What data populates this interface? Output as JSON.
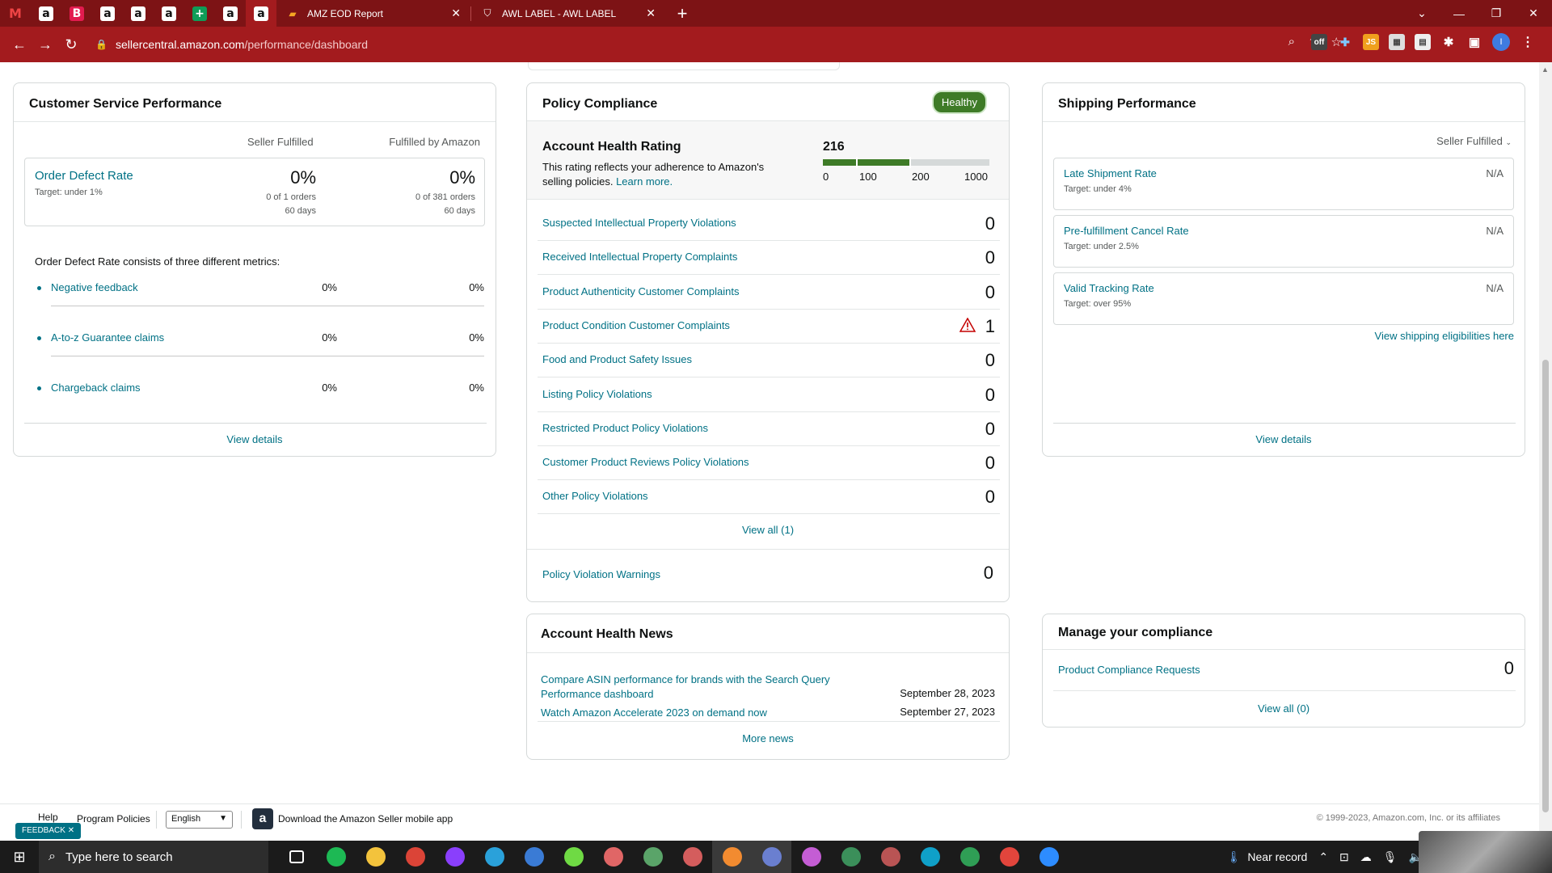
{
  "browser": {
    "pinned_tabs": [
      {
        "icon": "gmail-icon",
        "glyph": "M"
      },
      {
        "icon": "amazon-icon",
        "glyph": "a"
      },
      {
        "icon": "b-app-icon",
        "glyph": "B"
      },
      {
        "icon": "amazon-icon",
        "glyph": "a"
      },
      {
        "icon": "amazon-icon",
        "glyph": "a"
      },
      {
        "icon": "amazon-icon",
        "glyph": "a"
      },
      {
        "icon": "sheets-icon",
        "glyph": "+"
      },
      {
        "icon": "amazon-icon",
        "glyph": "a"
      },
      {
        "icon": "amazon-icon",
        "glyph": "a"
      }
    ],
    "tabs": [
      {
        "title": "AMZ EOD Report",
        "icon": "report-icon"
      },
      {
        "title": "AWL LABEL - AWL LABEL",
        "icon": "awl-icon"
      }
    ],
    "url_host": "sellercentral.amazon.com",
    "url_path": "/performance/dashboard",
    "profile_initial": "I"
  },
  "customer_service": {
    "title": "Customer Service Performance",
    "col_seller": "Seller Fulfilled",
    "col_amazon": "Fulfilled by Amazon",
    "odr": {
      "title": "Order Defect Rate",
      "target": "Target: under 1%",
      "seller_value": "0%",
      "seller_orders": "0 of 1 orders",
      "seller_period": "60 days",
      "amazon_value": "0%",
      "amazon_orders": "0 of 381 orders",
      "amazon_period": "60 days"
    },
    "consists": "Order Defect Rate consists of three different metrics:",
    "metrics": [
      {
        "name": "Negative feedback",
        "seller": "0%",
        "amazon": "0%"
      },
      {
        "name": "A-to-z Guarantee claims",
        "seller": "0%",
        "amazon": "0%"
      },
      {
        "name": "Chargeback claims",
        "seller": "0%",
        "amazon": "0%"
      }
    ],
    "view_details": "View details"
  },
  "policy": {
    "title": "Policy Compliance",
    "status": "Healthy",
    "ahr_title": "Account Health Rating",
    "ahr_desc": "This rating reflects your adherence to Amazon's selling policies.",
    "ahr_learn": "Learn more.",
    "ahr_score": "216",
    "ahr_ticks": [
      "0",
      "100",
      "200",
      "1000"
    ],
    "ahr_score_value": 216,
    "colors": {
      "bar_fill": "#3e7b27",
      "bar_empty": "#d5d9d9",
      "healthy": "#3e7b27",
      "warning": "#c40000"
    },
    "rows": [
      {
        "name": "Suspected Intellectual Property Violations",
        "count": "0",
        "warning": false
      },
      {
        "name": "Received Intellectual Property Complaints",
        "count": "0",
        "warning": false
      },
      {
        "name": "Product Authenticity Customer Complaints",
        "count": "0",
        "warning": false
      },
      {
        "name": "Product Condition Customer Complaints",
        "count": "1",
        "warning": true
      },
      {
        "name": "Food and Product Safety Issues",
        "count": "0",
        "warning": false
      },
      {
        "name": "Listing Policy Violations",
        "count": "0",
        "warning": false
      },
      {
        "name": "Restricted Product Policy Violations",
        "count": "0",
        "warning": false
      },
      {
        "name": "Customer Product Reviews Policy Violations",
        "count": "0",
        "warning": false
      },
      {
        "name": "Other Policy Violations",
        "count": "0",
        "warning": false
      }
    ],
    "view_all": "View all (1)",
    "warnings_label": "Policy Violation Warnings",
    "warnings_count": "0"
  },
  "shipping": {
    "title": "Shipping Performance",
    "dropdown": "Seller Fulfilled",
    "metrics": [
      {
        "name": "Late Shipment Rate",
        "target": "Target: under 4%",
        "value": "N/A"
      },
      {
        "name": "Pre-fulfillment Cancel Rate",
        "target": "Target: under 2.5%",
        "value": "N/A"
      },
      {
        "name": "Valid Tracking Rate",
        "target": "Target: over 95%",
        "value": "N/A"
      }
    ],
    "eligibilities": "View shipping eligibilities here",
    "view_details": "View details"
  },
  "news": {
    "title": "Account Health News",
    "items": [
      {
        "title": "Compare ASIN performance for brands with the Search Query Performance dashboard",
        "date": "September 28, 2023"
      },
      {
        "title": "Watch Amazon Accelerate 2023 on demand now",
        "date": "September 27, 2023"
      }
    ],
    "more": "More news"
  },
  "compliance": {
    "title": "Manage your compliance",
    "row_name": "Product Compliance Requests",
    "row_count": "0",
    "view_all": "View all (0)"
  },
  "footer": {
    "help": "Help",
    "program_policies": "Program Policies",
    "language": "English",
    "app_text": "Download the Amazon Seller mobile app",
    "copyright": "© 1999-2023, Amazon.com, Inc. or its affiliates",
    "feedback": "FEEDBACK"
  },
  "taskbar": {
    "search_placeholder": "Type here to search",
    "weather": "Near record"
  }
}
